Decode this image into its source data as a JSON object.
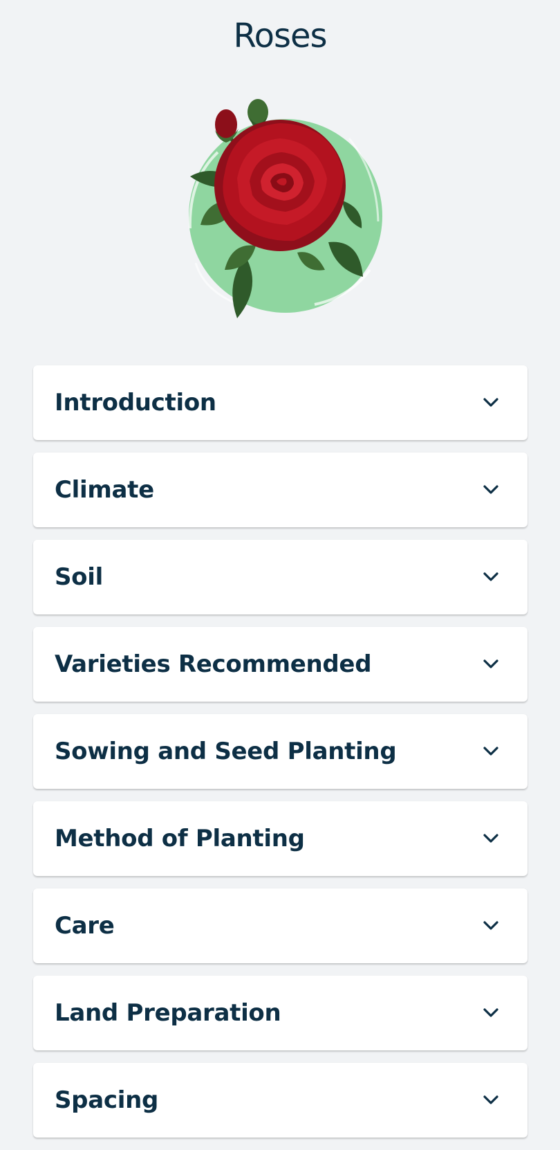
{
  "header": {
    "title": "Roses"
  },
  "hero": {
    "image": "red-rose-illustration",
    "accent_color": "#8fd6a0",
    "petal_color": "#b3121f",
    "leaf_color": "#2f5a2a"
  },
  "sections": [
    {
      "label": "Introduction",
      "icon": "chevron-down-icon"
    },
    {
      "label": "Climate",
      "icon": "chevron-down-icon"
    },
    {
      "label": "Soil",
      "icon": "chevron-down-icon"
    },
    {
      "label": "Varieties Recommended",
      "icon": "chevron-down-icon"
    },
    {
      "label": "Sowing and Seed Planting",
      "icon": "chevron-down-icon"
    },
    {
      "label": "Method of Planting",
      "icon": "chevron-down-icon"
    },
    {
      "label": "Care",
      "icon": "chevron-down-icon"
    },
    {
      "label": "Land Preparation",
      "icon": "chevron-down-icon"
    },
    {
      "label": "Spacing",
      "icon": "chevron-down-icon"
    }
  ],
  "theme": {
    "background": "#f1f3f5",
    "card": "#ffffff",
    "text": "#0d2f45"
  }
}
